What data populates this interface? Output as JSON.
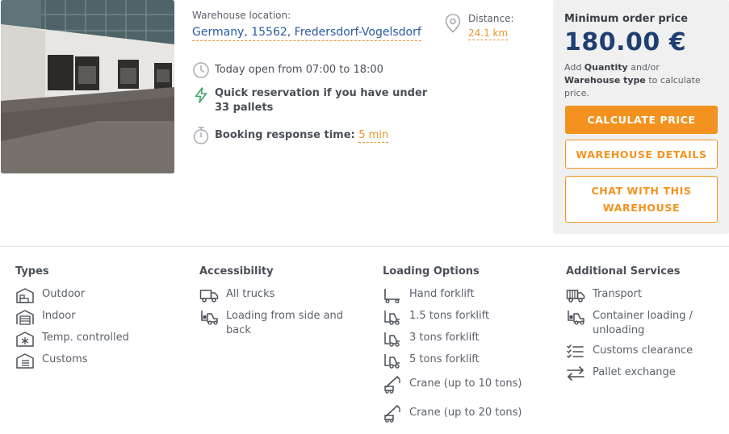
{
  "location": {
    "label": "Warehouse location:",
    "address": "Germany, 15562, Fredersdorf-Vogelsdorf"
  },
  "distance": {
    "label": "Distance:",
    "value": "24.1 km"
  },
  "features": {
    "hours": "Today open from 07:00 to 18:00",
    "reservation": "Quick reservation if you have under 33 pallets",
    "response_label": "Booking response time:",
    "response_value": "5 min"
  },
  "price": {
    "title": "Minimum order price",
    "amount": "180.00 €",
    "hint_prefix": "Add ",
    "hint_quantity": "Quantity",
    "hint_mid": " and/or ",
    "hint_type": "Warehouse type",
    "hint_suffix": " to calculate price.",
    "calculate_label": "CALCULATE PRICE",
    "details_label": "WAREHOUSE DETAILS",
    "chat_label": "CHAT WITH THIS WAREHOUSE"
  },
  "types": {
    "title": "Types",
    "items": [
      "Outdoor",
      "Indoor",
      "Temp. controlled",
      "Customs"
    ]
  },
  "accessibility": {
    "title": "Accessibility",
    "items": [
      "All trucks",
      "Loading from side and back"
    ]
  },
  "loading": {
    "title": "Loading Options",
    "items": [
      "Hand forklift",
      "1.5 tons forklift",
      "3 tons forklift",
      "5 tons forklift",
      "Crane (up to 10 tons)",
      "Crane (up to 20 tons)"
    ]
  },
  "services": {
    "title": "Additional Services",
    "items": [
      "Transport",
      "Container loading / unloading",
      "Customs clearance",
      "Pallet exchange"
    ]
  },
  "colors": {
    "accent": "#f3921e",
    "price": "#1f3f73",
    "link": "#2b5aa0",
    "lightning": "#3aa66a"
  }
}
